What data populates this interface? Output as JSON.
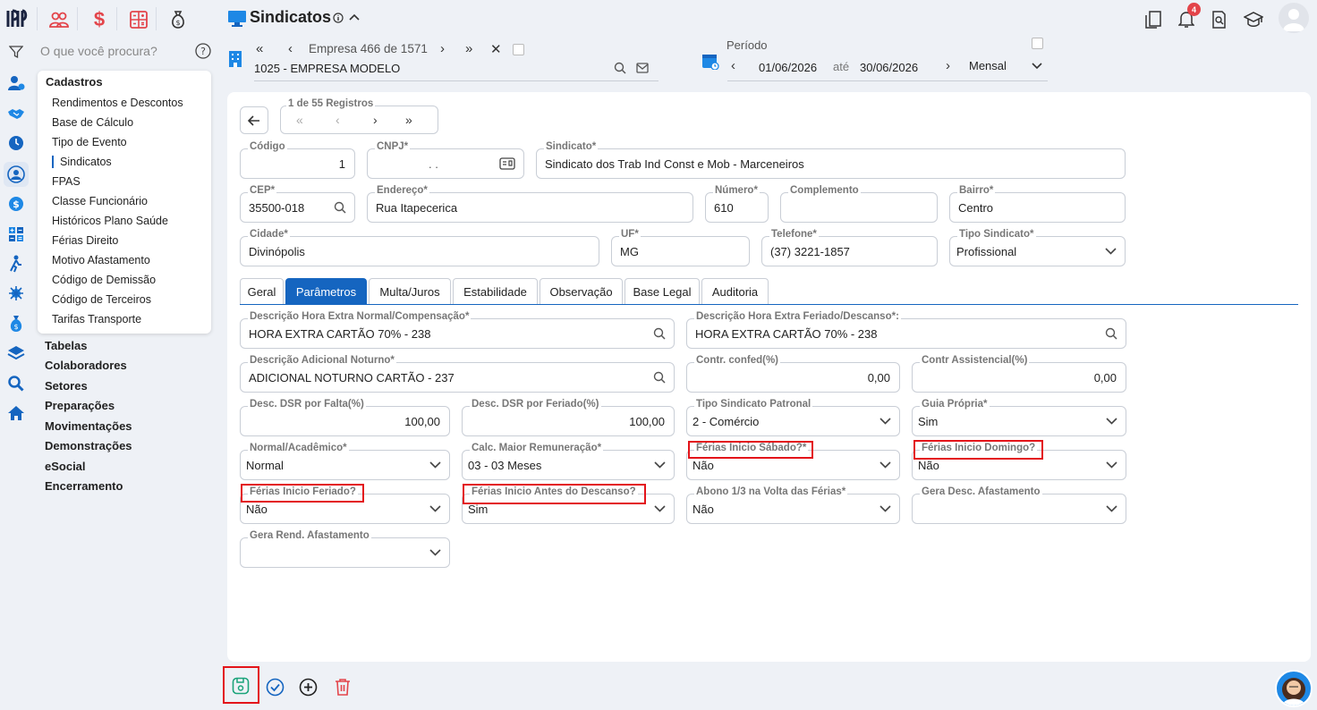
{
  "app": {
    "title": "Sindicatos",
    "search_placeholder": "O que você procura?",
    "notifications_count": "4"
  },
  "empresa": {
    "nav_text": "Empresa 466 de 1571",
    "name": "1025 - EMPRESA MODELO"
  },
  "periodo": {
    "label": "Período",
    "start": "01/06/2026",
    "between": "até",
    "end": "30/06/2026",
    "type": "Mensal"
  },
  "submenu": {
    "title": "Cadastros",
    "items": [
      "Rendimentos e Descontos",
      "Base de Cálculo",
      "Tipo de Evento",
      "Sindicatos",
      "FPAS",
      "Classe Funcionário",
      "Históricos Plano Saúde",
      "Férias Direito",
      "Motivo Afastamento",
      "Código de Demissão",
      "Código de Terceiros",
      "Tarifas Transporte"
    ]
  },
  "main_menu": [
    "Tabelas",
    "Colaboradores",
    "Setores",
    "Preparações",
    "Movimentações",
    "Demonstrações",
    "eSocial",
    "Encerramento"
  ],
  "records": {
    "label": "1 de 55 Registros"
  },
  "form": {
    "codigo": {
      "label": "Código",
      "value": "1"
    },
    "cnpj": {
      "label": "CNPJ*",
      "value": ".                   ."
    },
    "sindicato": {
      "label": "Sindicato*",
      "value": "Sindicato dos Trab Ind Const e Mob - Marceneiros"
    },
    "cep": {
      "label": "CEP*",
      "value": "35500-018"
    },
    "endereco": {
      "label": "Endereço*",
      "value": "Rua Itapecerica"
    },
    "numero": {
      "label": "Número*",
      "value": "610"
    },
    "complemento": {
      "label": "Complemento",
      "value": ""
    },
    "bairro": {
      "label": "Bairro*",
      "value": "Centro"
    },
    "cidade": {
      "label": "Cidade*",
      "value": "Divinópolis"
    },
    "uf": {
      "label": "UF*",
      "value": "MG"
    },
    "telefone": {
      "label": "Telefone*",
      "value": "(37) 3221-1857"
    },
    "tipo_sindicato": {
      "label": "Tipo Sindicato*",
      "value": "Profissional"
    }
  },
  "tabs": [
    "Geral",
    "Parâmetros",
    "Multa/Juros",
    "Estabilidade",
    "Observação",
    "Base Legal",
    "Auditoria"
  ],
  "params": {
    "hora_extra_normal": {
      "label": "Descrição Hora Extra Normal/Compensação*",
      "value": "HORA EXTRA CARTÃO 70% - 238"
    },
    "hora_extra_feriado": {
      "label": "Descrição Hora Extra Feriado/Descanso*:",
      "value": "HORA EXTRA CARTÃO 70% - 238"
    },
    "adicional_noturno": {
      "label": "Descrição Adicional Noturno*",
      "value": "ADICIONAL NOTURNO CARTÃO - 237"
    },
    "contr_confed": {
      "label": "Contr. confed(%)",
      "value": "0,00"
    },
    "contr_assistencial": {
      "label": "Contr Assistencial(%)",
      "value": "0,00"
    },
    "dsr_falta": {
      "label": "Desc. DSR por Falta(%)",
      "value": "100,00"
    },
    "dsr_feriado": {
      "label": "Desc. DSR por Feriado(%)",
      "value": "100,00"
    },
    "tipo_patronal": {
      "label": "Tipo Sindicato Patronal",
      "value": "2 - Comércio"
    },
    "guia_propria": {
      "label": "Guia Própria*",
      "value": "Sim"
    },
    "normal_academico": {
      "label": "Normal/Acadêmico*",
      "value": "Normal"
    },
    "calc_maior": {
      "label": "Calc. Maior Remuneração*",
      "value": "03 - 03 Meses"
    },
    "ferias_sabado": {
      "label": "Férias Inicio Sábado?*",
      "value": "Não"
    },
    "ferias_domingo": {
      "label": "Férias Inicio Domingo?",
      "value": "Não"
    },
    "ferias_feriado": {
      "label": "Férias Inicio Feriado?",
      "value": "Não"
    },
    "ferias_antes_descanso": {
      "label": "Férias Inicio Antes do Descanso?",
      "value": "Sim"
    },
    "abono": {
      "label": "Abono 1/3 na Volta das Férias*",
      "value": "Não"
    },
    "gera_desc_afast": {
      "label": "Gera Desc. Afastamento",
      "value": ""
    },
    "gera_rend_afast": {
      "label": "Gera Rend. Afastamento",
      "value": ""
    }
  },
  "colors": {
    "primary": "#1565c0",
    "highlight": "#e3141a",
    "brand_red": "#e3444a",
    "save_green": "#1aa37a"
  }
}
